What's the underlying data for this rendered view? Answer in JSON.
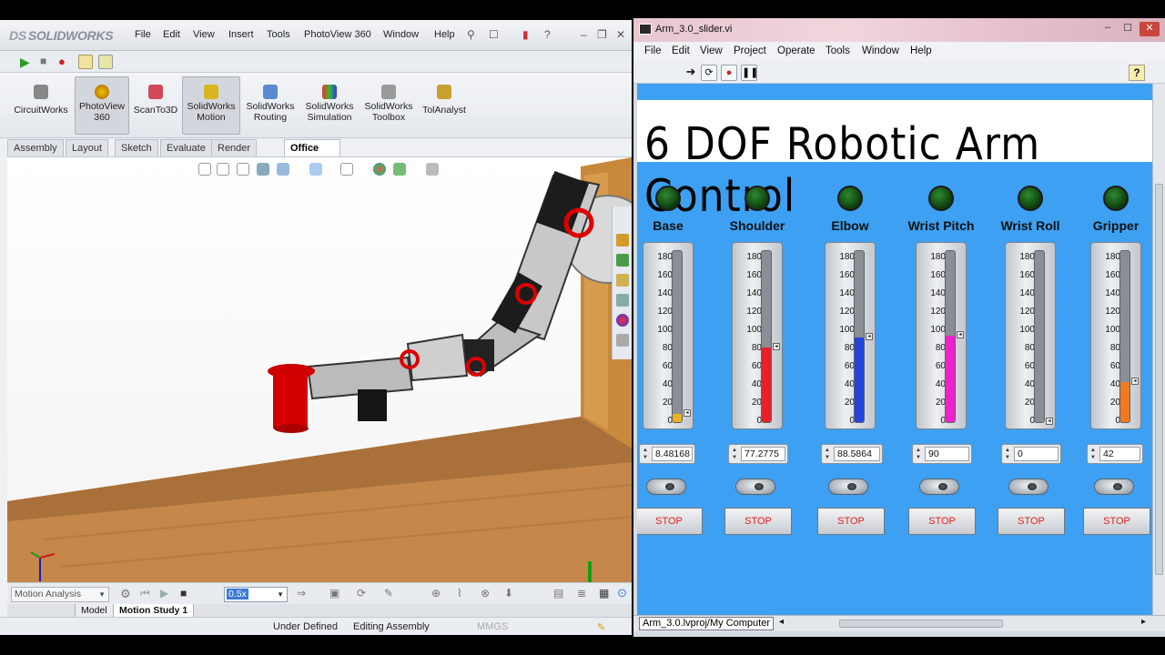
{
  "solidworks": {
    "logo": "SOLIDWORKS",
    "logo_prefix": "DS",
    "menus": [
      "File",
      "Edit",
      "View",
      "Insert",
      "Tools",
      "PhotoView 360",
      "Window",
      "Help"
    ],
    "command_manager": [
      {
        "label": "CircuitWorks",
        "icon": "circuitworks-icon"
      },
      {
        "label": "PhotoView 360",
        "icon": "photoview-icon"
      },
      {
        "label": "ScanTo3D",
        "icon": "scanto3d-icon"
      },
      {
        "label": "SolidWorks Motion",
        "icon": "motion-icon"
      },
      {
        "label": "SolidWorks Routing",
        "icon": "routing-icon"
      },
      {
        "label": "SolidWorks Simulation",
        "icon": "simulation-icon"
      },
      {
        "label": "SolidWorks Toolbox",
        "icon": "toolbox-icon"
      },
      {
        "label": "TolAnalyst",
        "icon": "tolanalyst-icon"
      }
    ],
    "tabs": [
      "Assembly",
      "Layout",
      "Sketch",
      "Evaluate",
      "Render Tools",
      "Office Products"
    ],
    "active_tab": "Office Products",
    "motion_study_type": "Motion Analysis",
    "playback_speed": "0.5x",
    "bottom_tabs": [
      "Model",
      "Motion Study 1"
    ],
    "status": [
      "Under Defined",
      "Editing Assembly",
      "MMGS"
    ]
  },
  "labview": {
    "title": "Arm_3.0_slider.vi",
    "menus": [
      "File",
      "Edit",
      "View",
      "Project",
      "Operate",
      "Tools",
      "Window",
      "Help"
    ],
    "heading": "6 DOF Robotic Arm Control",
    "scale_ticks": [
      "180",
      "160",
      "140",
      "120",
      "100",
      "80",
      "60",
      "40",
      "20",
      "0"
    ],
    "joints": [
      {
        "label": "Base",
        "value": "8.48168",
        "fraction": 0.047,
        "color": "#f0b020",
        "stop": "STOP"
      },
      {
        "label": "Shoulder",
        "value": "77.2775",
        "fraction": 0.429,
        "color": "#e8202a",
        "stop": "STOP"
      },
      {
        "label": "Elbow",
        "value": "88.5864",
        "fraction": 0.492,
        "color": "#2244dd",
        "stop": "STOP"
      },
      {
        "label": "Wrist Pitch",
        "value": "90",
        "fraction": 0.5,
        "color": "#ee22cc",
        "stop": "STOP"
      },
      {
        "label": "Wrist Roll",
        "value": "0",
        "fraction": 0.0,
        "color": "#a8d040",
        "stop": "STOP"
      },
      {
        "label": "Gripper",
        "value": "42",
        "fraction": 0.233,
        "color": "#f07a20",
        "stop": "STOP"
      }
    ],
    "project_path": "Arm_3.0.lvproj/My Computer"
  }
}
